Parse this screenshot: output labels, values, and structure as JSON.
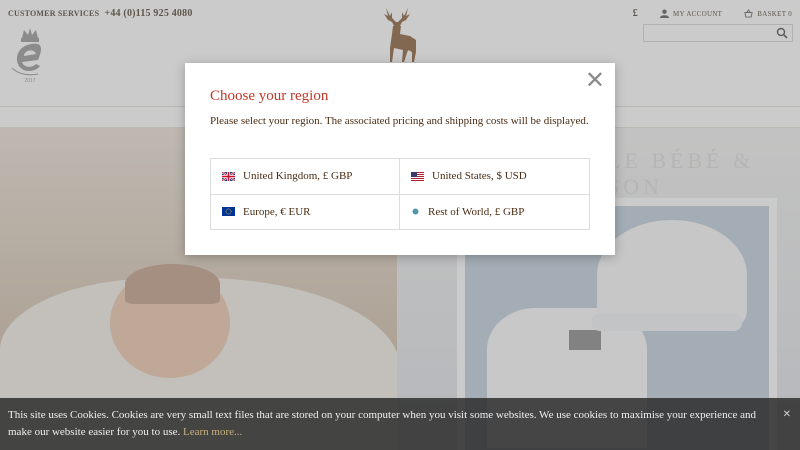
{
  "header": {
    "customer_services_label": "CUSTOMER SERVICES",
    "phone": "+44 (0)115 925 4080",
    "award_year": "2017",
    "currency_symbol": "£",
    "my_account": "MY ACCOUNT",
    "basket": "BASKET 0",
    "search_placeholder": ""
  },
  "hero": {
    "embossed_text": "LE BÉBÉ & SON"
  },
  "modal": {
    "title": "Choose your region",
    "text": "Please select your region. The associated pricing and shipping costs will be displayed.",
    "close_symbol": "✕",
    "regions": [
      {
        "label": "United Kingdom, £ GBP",
        "icon": "uk-flag-icon"
      },
      {
        "label": "United States, $ USD",
        "icon": "us-flag-icon"
      },
      {
        "label": "Europe, € EUR",
        "icon": "eu-flag-icon"
      },
      {
        "label": "Rest of World, £ GBP",
        "icon": "globe-icon"
      }
    ]
  },
  "cookie_bar": {
    "text": "This site uses Cookies. Cookies are very small text files that are stored on your computer when you visit some websites. We use cookies to maximise your experience and make our website easier for you to use.",
    "link": "Learn more...",
    "close_symbol": "✕"
  },
  "colors": {
    "title_red": "#c0392b",
    "brand_brown": "#7a4a22",
    "text_brown": "#4a2c12"
  }
}
